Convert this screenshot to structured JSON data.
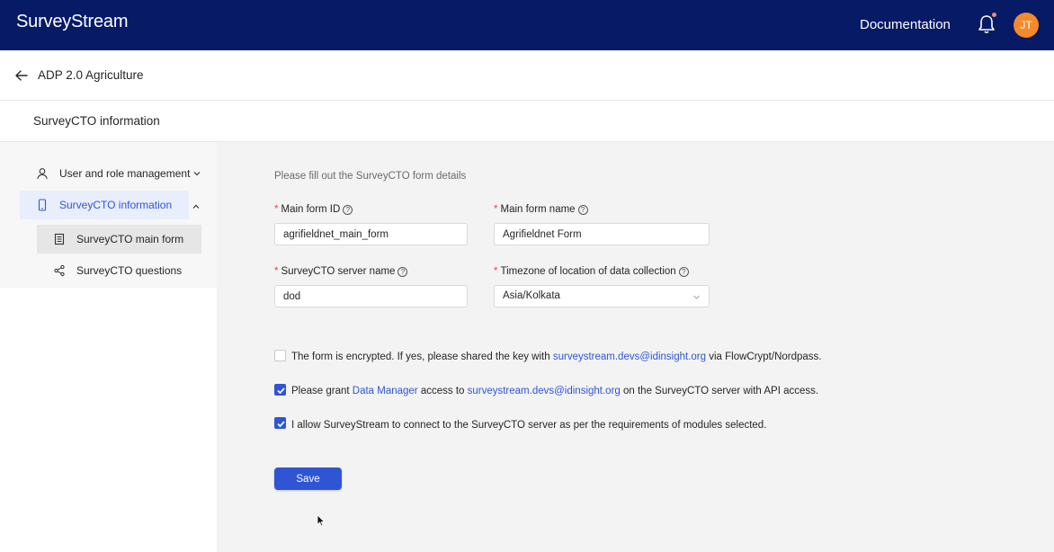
{
  "app": {
    "brand": "SurveyStream"
  },
  "header": {
    "documentation_label": "Documentation",
    "avatar_initials": "JT"
  },
  "breadcrumb": {
    "title": "ADP 2.0 Agriculture"
  },
  "section": {
    "title": "SurveyCTO information"
  },
  "sidebar": {
    "items": [
      {
        "label": "User and role management"
      },
      {
        "label": "SurveyCTO information"
      },
      {
        "label": "SurveyCTO main form"
      },
      {
        "label": "SurveyCTO questions"
      }
    ]
  },
  "form": {
    "hint": "Please fill out the SurveyCTO form details",
    "required_mark": "*",
    "help_mark": "?",
    "main_form_id": {
      "label": "Main form ID",
      "value": "agrifieldnet_main_form"
    },
    "main_form_name": {
      "label": "Main form name",
      "value": "Agrifieldnet Form"
    },
    "server_name": {
      "label": "SurveyCTO server name",
      "value": "dod"
    },
    "timezone": {
      "label": "Timezone of location of data collection",
      "value": "Asia/Kolkata"
    },
    "checks": {
      "encrypted": {
        "checked": false,
        "pre": "The form is encrypted. If yes, please shared the key with ",
        "email": "surveystream.devs@idinsight.org",
        "post": " via FlowCrypt/Nordpass."
      },
      "grant": {
        "checked": true,
        "pre": "Please grant ",
        "link": "Data Manager",
        "mid": " access to ",
        "email": "surveystream.devs@idinsight.org",
        "post": " on the SurveyCTO server with API access."
      },
      "allow": {
        "checked": true,
        "text": "I allow SurveyStream to connect to the SurveyCTO server as per the requirements of modules selected."
      }
    },
    "save_label": "Save"
  },
  "colors": {
    "topbar": "#061a66",
    "accent": "#2f55d4",
    "avatar": "#f48a2a",
    "required": "#e5484d"
  }
}
